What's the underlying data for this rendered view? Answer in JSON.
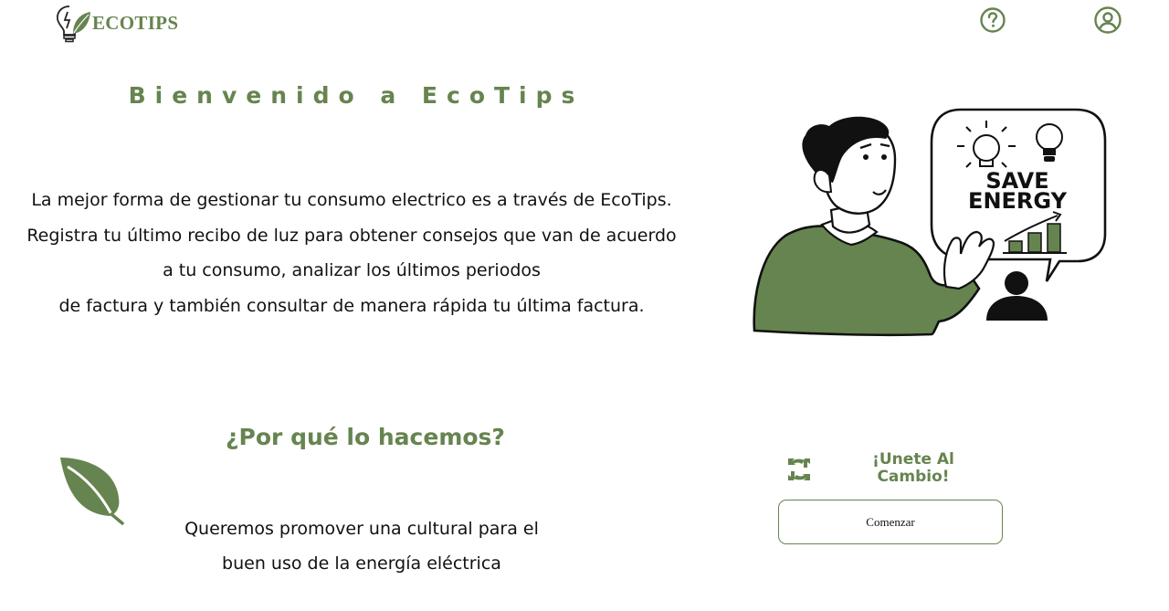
{
  "header": {
    "brand": "ECOTIPS",
    "logo_icon": "lightbulb-leaf-icon",
    "help_icon": "question-circle-icon",
    "profile_icon": "user-circle-icon"
  },
  "hero": {
    "title": "Bienvenido a EcoTips",
    "intro_lines": [
      "La mejor forma de gestionar tu consumo electrico es a través de EcoTips.",
      "Registra tu último recibo de luz para obtener consejos que van de acuerdo",
      "a tu consumo, analizar los últimos periodos",
      "de factura y también consultar de manera rápida tu última factura."
    ],
    "illustration_text": [
      "SAVE",
      "ENERGY"
    ]
  },
  "why": {
    "title": "¿Por qué lo hacemos?",
    "lines": [
      "Queremos promover una cultural para el",
      "buen uso de la energía eléctrica"
    ]
  },
  "join": {
    "title_lines": [
      "¡Unete Al",
      "Cambio!"
    ],
    "button_label": "Comenzar"
  },
  "colors": {
    "accent": "#66844f",
    "text": "#111111",
    "background": "#ffffff"
  }
}
